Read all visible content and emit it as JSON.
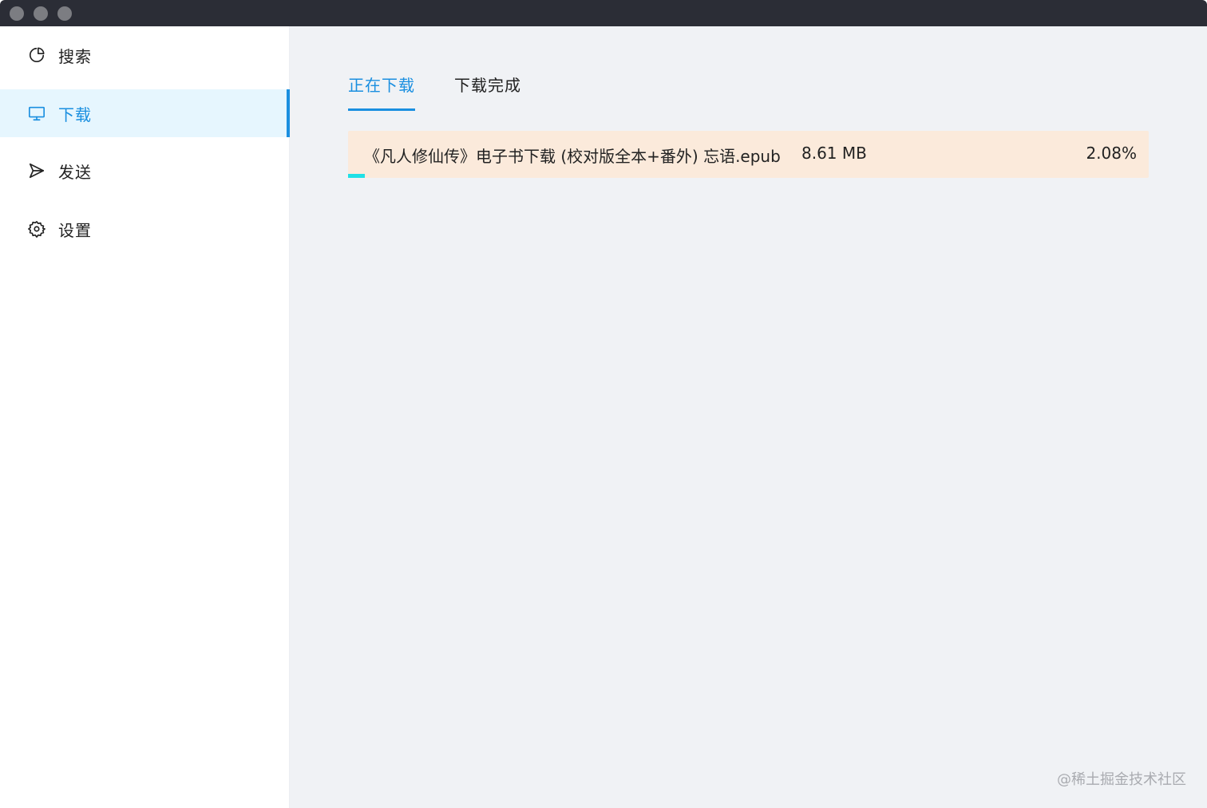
{
  "sidebar": {
    "items": [
      {
        "label": "搜索",
        "icon": "pie-chart-icon",
        "active": false
      },
      {
        "label": "下载",
        "icon": "monitor-icon",
        "active": true
      },
      {
        "label": "发送",
        "icon": "send-icon",
        "active": false
      },
      {
        "label": "设置",
        "icon": "gear-icon",
        "active": false
      }
    ]
  },
  "tabs": [
    {
      "label": "正在下载",
      "active": true
    },
    {
      "label": "下载完成",
      "active": false
    }
  ],
  "downloads": [
    {
      "name": "《凡人修仙传》电子书下载 (校对版全本+番外) 忘语.epub",
      "size": "8.61 MB",
      "percent": "2.08%",
      "progress": 0.0208
    }
  ],
  "watermark": "@稀土掘金技术社区",
  "colors": {
    "accent": "#1a8fe0",
    "progress": "#1fe0e6",
    "row_bg": "#fbeadb",
    "titlebar": "#2b2d36"
  }
}
